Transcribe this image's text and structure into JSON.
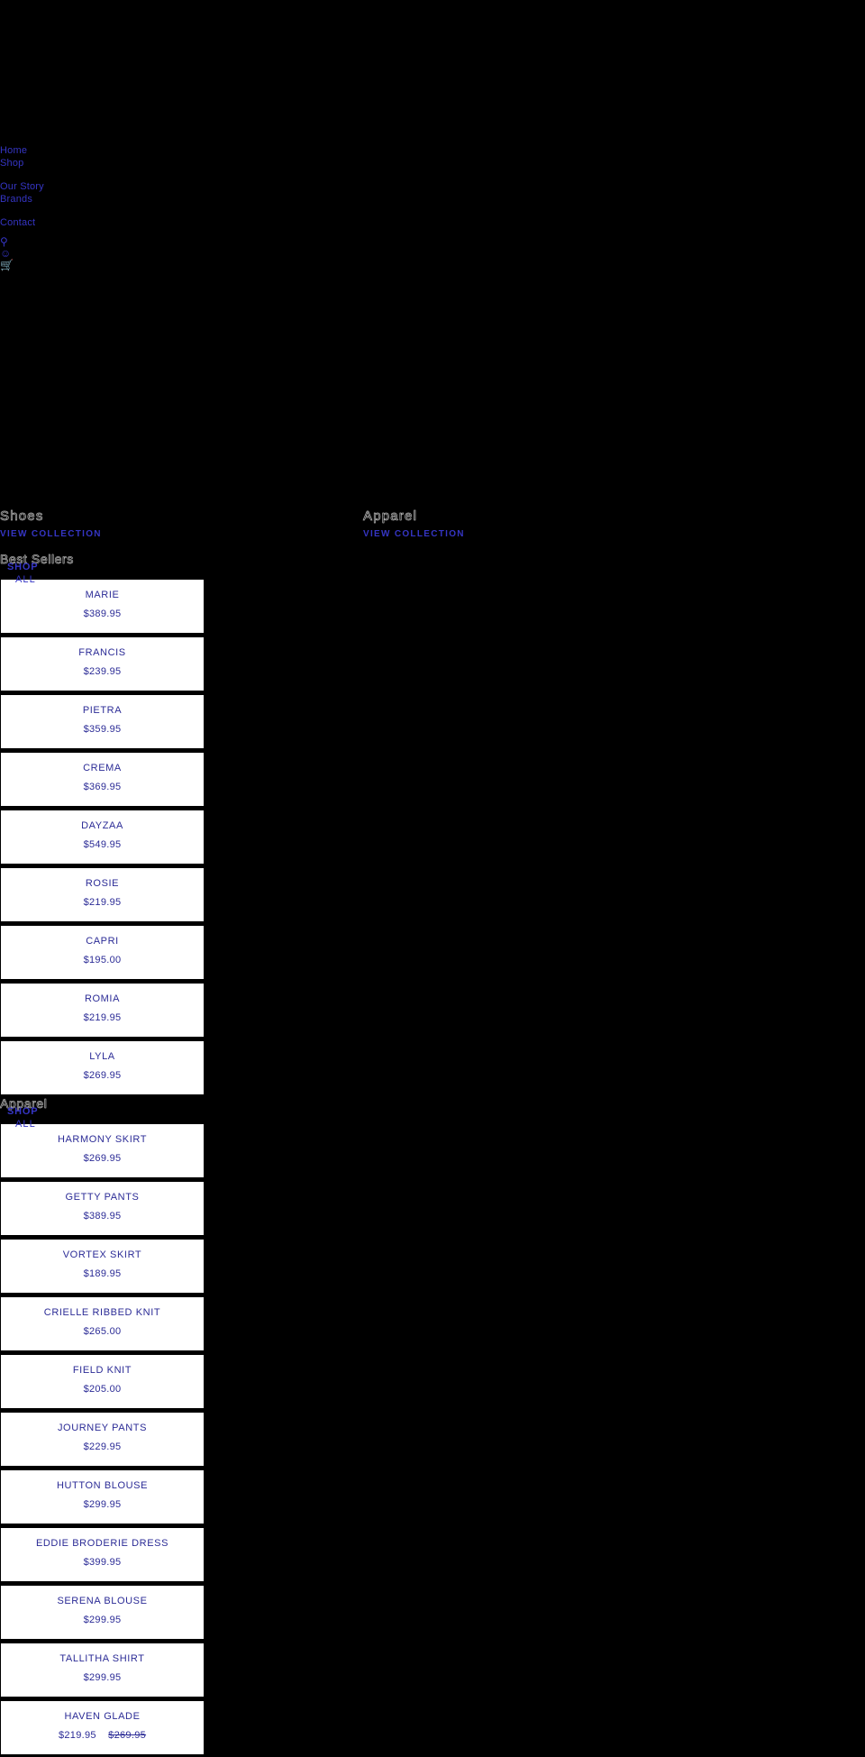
{
  "nav": {
    "primary": [
      {
        "label": "Home",
        "name": "nav-link-home"
      },
      {
        "label": "Shop",
        "name": "nav-link-shop"
      }
    ],
    "secondary": [
      {
        "label": "Our Story",
        "name": "nav-link-our-story"
      },
      {
        "label": "Brands",
        "name": "nav-link-brands"
      }
    ],
    "tertiary": [
      {
        "label": "Contact",
        "name": "nav-link-contact"
      }
    ],
    "icons": [
      {
        "glyph": "⌕",
        "name": "search-icon"
      },
      {
        "glyph": "☺",
        "name": "account-icon"
      },
      {
        "glyph": "Ὥ2",
        "name": "cart-icon"
      }
    ]
  },
  "collections": [
    {
      "title": "Shoes",
      "view_label": "VIEW COLLECTION",
      "name": "collection-shoes"
    },
    {
      "title": "Apparel",
      "view_label": "VIEW COLLECTION",
      "name": "collection-apparel"
    }
  ],
  "sections": [
    {
      "band_title": "Best Sellers",
      "shop_label": "SHOP",
      "shop_all_label": "ALL",
      "products": [
        {
          "name": "MARIE",
          "price": "$389.95",
          "compare_at": ""
        },
        {
          "name": "FRANCIS",
          "price": "$239.95",
          "compare_at": ""
        },
        {
          "name": "PIETRA",
          "price": "$359.95",
          "compare_at": ""
        },
        {
          "name": "CREMA",
          "price": "$369.95",
          "compare_at": ""
        },
        {
          "name": "DAYZAA",
          "price": "$549.95",
          "compare_at": ""
        },
        {
          "name": "ROSIE",
          "price": "$219.95",
          "compare_at": ""
        },
        {
          "name": "CAPRI",
          "price": "$195.00",
          "compare_at": ""
        },
        {
          "name": "ROMIA",
          "price": "$219.95",
          "compare_at": ""
        },
        {
          "name": "LYLA",
          "price": "$269.95",
          "compare_at": ""
        }
      ]
    },
    {
      "band_title": "Apparel",
      "shop_label": "SHOP",
      "shop_all_label": "ALL",
      "products": [
        {
          "name": "HARMONY SKIRT",
          "price": "$269.95",
          "compare_at": ""
        },
        {
          "name": "GETTY PANTS",
          "price": "$389.95",
          "compare_at": ""
        },
        {
          "name": "VORTEX SKIRT",
          "price": "$189.95",
          "compare_at": ""
        },
        {
          "name": "CRIELLE RIBBED KNIT",
          "price": "$265.00",
          "compare_at": ""
        },
        {
          "name": "FIELD KNIT",
          "price": "$205.00",
          "compare_at": ""
        },
        {
          "name": "JOURNEY PANTS",
          "price": "$229.95",
          "compare_at": ""
        },
        {
          "name": "HUTTON BLOUSE",
          "price": "$299.95",
          "compare_at": ""
        },
        {
          "name": "EDDIE BRODERIE DRESS",
          "price": "$399.95",
          "compare_at": ""
        },
        {
          "name": "SERENA BLOUSE",
          "price": "$299.95",
          "compare_at": ""
        },
        {
          "name": "TALLITHA SHIRT",
          "price": "$299.95",
          "compare_at": ""
        },
        {
          "name": "HAVEN GLADE",
          "price": "$219.95",
          "compare_at": "$269.95"
        }
      ]
    }
  ],
  "colors": {
    "background": "#000000",
    "link": "#3535c4",
    "product_text": "#2b2b96",
    "card_background": "#ffffff"
  }
}
